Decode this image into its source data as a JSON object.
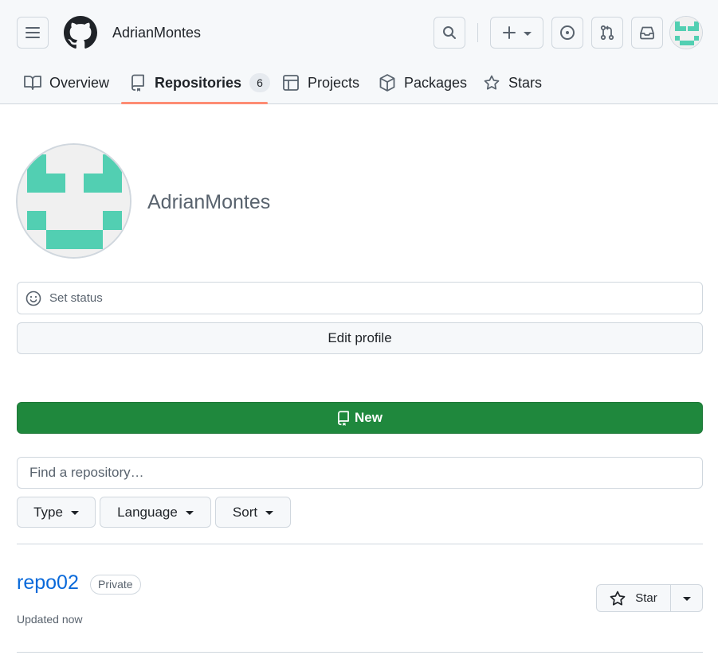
{
  "header": {
    "username": "AdrianMontes",
    "icons": {
      "menu": "hamburger-icon",
      "logo": "github-logo",
      "search": "search-icon",
      "create": "plus-icon",
      "issues": "issue-opened-icon",
      "pulls": "git-pull-request-icon",
      "inbox": "inbox-icon"
    }
  },
  "tabs": [
    {
      "label": "Overview",
      "icon": "book-icon"
    },
    {
      "label": "Repositories",
      "icon": "repo-icon",
      "count": "6",
      "active": true
    },
    {
      "label": "Projects",
      "icon": "table-icon"
    },
    {
      "label": "Packages",
      "icon": "package-icon"
    },
    {
      "label": "Stars",
      "icon": "star-icon"
    }
  ],
  "profile": {
    "name": "AdrianMontes",
    "set_status": "Set status",
    "edit_profile": "Edit profile"
  },
  "repos_toolbar": {
    "new_label": "New",
    "find_placeholder": "Find a repository…",
    "filters": [
      "Type",
      "Language",
      "Sort"
    ]
  },
  "repos": [
    {
      "name": "repo02",
      "visibility": "Private",
      "updated": "Updated now",
      "star_label": "Star"
    }
  ],
  "colors": {
    "accent_green": "#1f883d",
    "link_blue": "#0969da",
    "tab_underline": "#fd8c73",
    "identicon": "#52cfb2"
  }
}
